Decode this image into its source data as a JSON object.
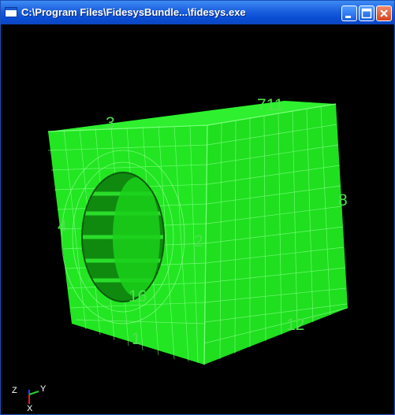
{
  "window": {
    "title": "C:\\Program Files\\FidesysBundle...\\fidesys.exe",
    "icon": "app-window-icon",
    "buttons": [
      "minimize",
      "maximize",
      "close"
    ]
  },
  "viewport": {
    "background": "#000000",
    "mesh_color": "#1ee01e",
    "mesh_line_color": "#7dff7d",
    "curve_labels": [
      "3",
      "711",
      "8",
      "4",
      "2",
      "16",
      "1",
      "12"
    ]
  },
  "axes_triad": {
    "labels": [
      "Z",
      "Y",
      "X"
    ],
    "colors": [
      "#3a3aff",
      "#2ad02a",
      "#e02020"
    ]
  }
}
